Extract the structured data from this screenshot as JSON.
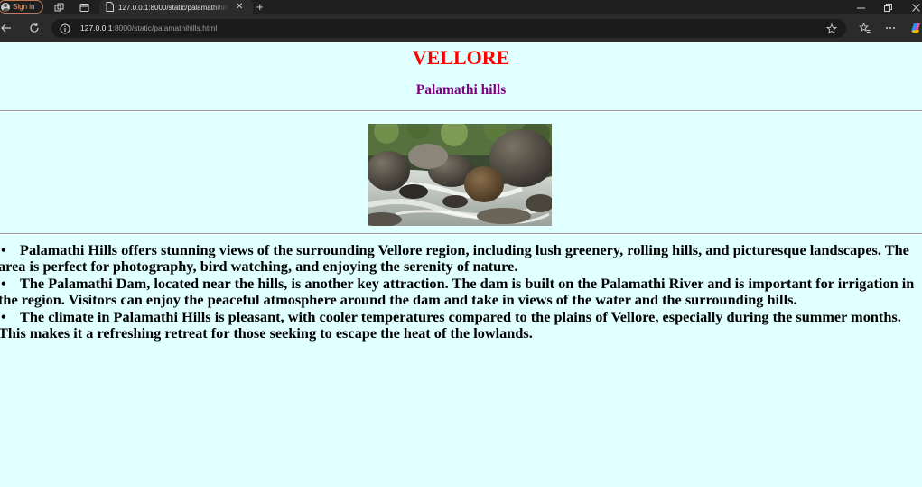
{
  "browser": {
    "signin_label": "Sign in",
    "tab_title": "127.0.0.1:8000/static/palamathihills.html",
    "url_host": "127.0.0.1",
    "url_rest": ":8000/static/palamathihills.html"
  },
  "page": {
    "heading": "VELLORE",
    "subheading": "Palamathi hills",
    "image_subject": "rocky stream with boulders and white water",
    "bullets": [
      "Palamathi Hills offers stunning views of the surrounding Vellore region, including lush greenery, rolling hills, and picturesque landscapes. The area is perfect for photography, bird watching, and enjoying the serenity of nature.",
      "The Palamathi Dam, located near the hills, is another key attraction. The dam is built on the Palamathi River and is important for irrigation in the region. Visitors can enjoy the peaceful atmosphere around the dam and take in views of the water and the surrounding hills.",
      "The climate in Palamathi Hills is pleasant, with cooler temperatures compared to the plains of Vellore, especially during the summer months. This makes it a refreshing retreat for those seeking to escape the heat of the lowlands."
    ]
  },
  "colors": {
    "page_background": "#e0ffff",
    "heading": "#ff0000",
    "subheading": "#800080"
  },
  "icons": [
    "person-icon",
    "workspaces-icon",
    "tab-actions-icon",
    "page-icon",
    "close-icon",
    "plus-icon",
    "minimize-icon",
    "restore-icon",
    "back-arrow-icon",
    "refresh-icon",
    "info-icon",
    "star-icon",
    "favorites-icon",
    "more-icon",
    "copilot-icon"
  ]
}
